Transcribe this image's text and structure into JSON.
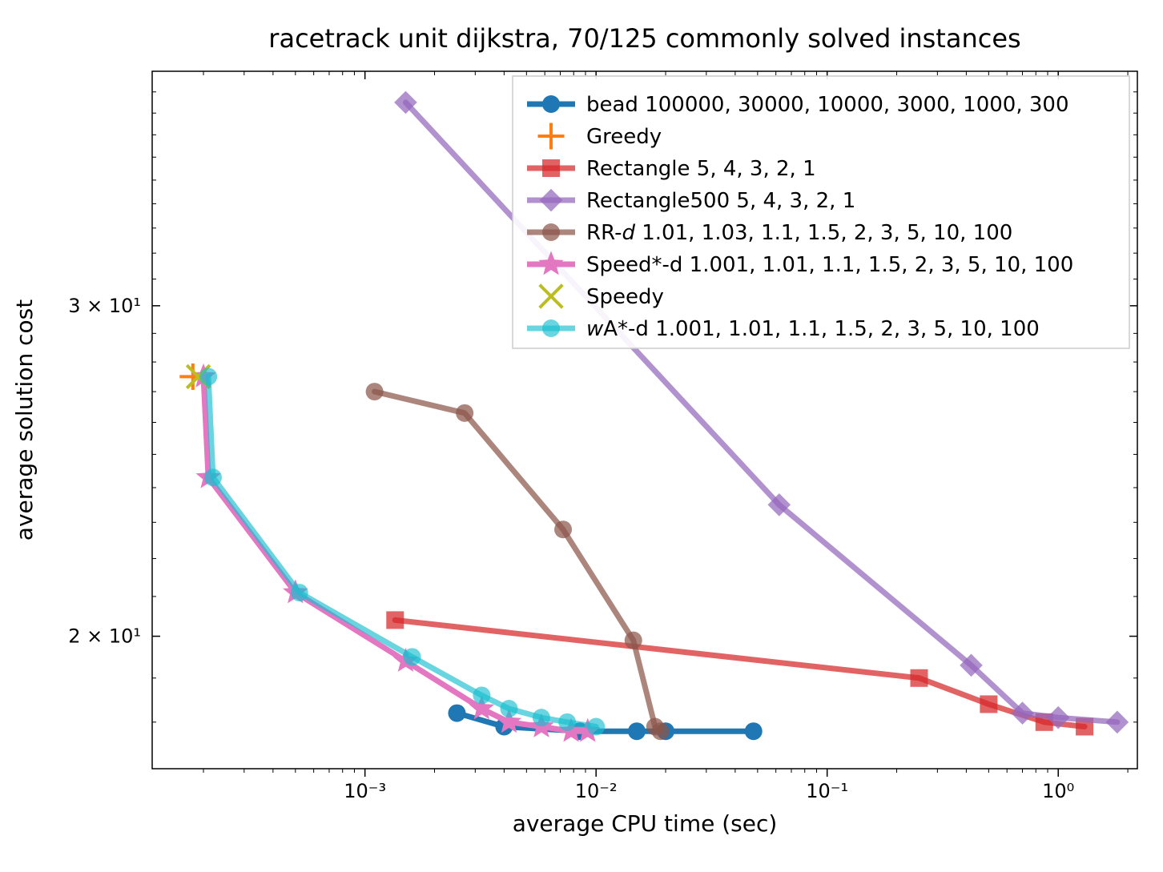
{
  "chart_data": {
    "type": "line",
    "title": "racetrack unit dijkstra, 70/125 commonly solved instances",
    "xlabel": "average CPU time (sec)",
    "ylabel": "average solution cost",
    "xscale": "log",
    "yscale": "log",
    "xlim": [
      0.00012,
      2.2
    ],
    "ylim": [
      17,
      40
    ],
    "xticks_major": [
      0.001,
      0.01,
      0.1,
      1
    ],
    "xticks_major_labels": [
      "10⁻³",
      "10⁻²",
      "10⁻¹",
      "10⁰"
    ],
    "yticks_custom": [
      {
        "value": 20,
        "label": "2 × 10¹"
      },
      {
        "value": 30,
        "label": "3 × 10¹"
      }
    ],
    "series": [
      {
        "name": "bead 100000, 30000, 10000, 3000, 1000, 300",
        "color": "#1f77b4",
        "marker": "circle",
        "points": [
          {
            "x": 0.048,
            "y": 17.8
          },
          {
            "x": 0.02,
            "y": 17.8
          },
          {
            "x": 0.015,
            "y": 17.8
          },
          {
            "x": 0.0085,
            "y": 17.8
          },
          {
            "x": 0.004,
            "y": 17.9
          },
          {
            "x": 0.0025,
            "y": 18.2
          }
        ]
      },
      {
        "name": "Greedy",
        "color": "#ff7f0e",
        "marker": "plus",
        "points": [
          {
            "x": 0.00018,
            "y": 27.5
          }
        ]
      },
      {
        "name": "Rectangle 5, 4, 3, 2, 1",
        "color": "#d62728",
        "marker": "square",
        "alpha": 0.72,
        "points": [
          {
            "x": 0.00135,
            "y": 20.4
          },
          {
            "x": 0.25,
            "y": 19.0
          },
          {
            "x": 0.5,
            "y": 18.4
          },
          {
            "x": 0.87,
            "y": 18.0
          },
          {
            "x": 1.3,
            "y": 17.9
          }
        ]
      },
      {
        "name": "Rectangle500 5, 4, 3, 2, 1",
        "color": "#9467bd",
        "marker": "diamond",
        "alpha": 0.72,
        "points": [
          {
            "x": 0.0015,
            "y": 38.5
          },
          {
            "x": 0.062,
            "y": 23.5
          },
          {
            "x": 0.42,
            "y": 19.3
          },
          {
            "x": 0.7,
            "y": 18.2
          },
          {
            "x": 1.0,
            "y": 18.1
          },
          {
            "x": 1.8,
            "y": 18.0
          }
        ]
      },
      {
        "name": "RR-d 1.01, 1.03, 1.1, 1.5, 2, 3, 5, 10, 100",
        "name_italic_index": 3,
        "color": "#8c564b",
        "marker": "circle",
        "alpha": 0.72,
        "points": [
          {
            "x": 0.0011,
            "y": 27.0
          },
          {
            "x": 0.0027,
            "y": 26.3
          },
          {
            "x": 0.0072,
            "y": 22.8
          },
          {
            "x": 0.0145,
            "y": 19.9
          },
          {
            "x": 0.018,
            "y": 17.9
          },
          {
            "x": 0.019,
            "y": 17.8
          }
        ]
      },
      {
        "name": "Speed*-d 1.001, 1.01, 1.1, 1.5, 2, 3, 5, 10, 100",
        "color": "#e377c2",
        "marker": "star",
        "points": [
          {
            "x": 0.0002,
            "y": 27.5
          },
          {
            "x": 0.00021,
            "y": 24.3
          },
          {
            "x": 0.0005,
            "y": 21.1
          },
          {
            "x": 0.0015,
            "y": 19.4
          },
          {
            "x": 0.0032,
            "y": 18.3
          },
          {
            "x": 0.0042,
            "y": 18.0
          },
          {
            "x": 0.0058,
            "y": 17.9
          },
          {
            "x": 0.0078,
            "y": 17.8
          },
          {
            "x": 0.0092,
            "y": 17.8
          }
        ]
      },
      {
        "name": "Speedy",
        "color": "#bcbd22",
        "marker": "x",
        "points": [
          {
            "x": 0.00019,
            "y": 27.5
          }
        ]
      },
      {
        "name": "wA*-d 1.001, 1.01, 1.1, 1.5, 2, 3, 5, 10, 100",
        "name_italic_index": 0,
        "color": "#17becf",
        "marker": "circle",
        "alpha": 0.65,
        "points": [
          {
            "x": 0.00021,
            "y": 27.5
          },
          {
            "x": 0.00022,
            "y": 24.3
          },
          {
            "x": 0.00052,
            "y": 21.1
          },
          {
            "x": 0.0016,
            "y": 19.5
          },
          {
            "x": 0.0032,
            "y": 18.6
          },
          {
            "x": 0.0042,
            "y": 18.3
          },
          {
            "x": 0.0058,
            "y": 18.1
          },
          {
            "x": 0.0075,
            "y": 18.0
          },
          {
            "x": 0.01,
            "y": 17.9
          }
        ]
      }
    ],
    "legend": {
      "position": "upper-right-inside"
    }
  }
}
